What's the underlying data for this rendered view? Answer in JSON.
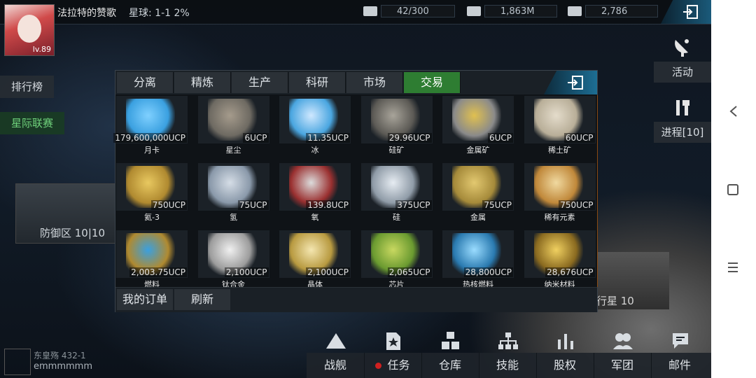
{
  "player": {
    "name": "法拉特的赞歌",
    "level": "lv.89",
    "planet": "星球: 1-1  2%"
  },
  "resources": [
    {
      "icon": "energy-icon",
      "value": "42/300"
    },
    {
      "icon": "money-icon",
      "value": "1,863M"
    },
    {
      "icon": "card-icon",
      "value": "2,786"
    }
  ],
  "left_menu": {
    "ranking": "排行榜",
    "league": "星际联赛",
    "defense": "防御区 10|10"
  },
  "right_menu": {
    "activity": "活动",
    "progress": "进程[10]",
    "planet": "行星 10"
  },
  "modal": {
    "tabs": [
      "分离",
      "精炼",
      "生产",
      "科研",
      "市场",
      "交易"
    ],
    "active_tab": "交易",
    "items": [
      {
        "name": "月卡",
        "price": "179,600,000UCP",
        "icon": "card-icon"
      },
      {
        "name": "星尘",
        "price": "6UCP",
        "icon": "stardust-icon"
      },
      {
        "name": "冰",
        "price": "11.35UCP",
        "icon": "ice-icon"
      },
      {
        "name": "硅矿",
        "price": "29.96UCP",
        "icon": "silicon-ore-icon"
      },
      {
        "name": "金属矿",
        "price": "6UCP",
        "icon": "metal-ore-icon"
      },
      {
        "name": "稀土矿",
        "price": "60UCP",
        "icon": "rare-earth-icon"
      },
      {
        "name": "氦-3",
        "price": "750UCP",
        "icon": "helium-icon"
      },
      {
        "name": "氢",
        "price": "75UCP",
        "icon": "hydrogen-icon"
      },
      {
        "name": "氧",
        "price": "139.8UCP",
        "icon": "oxygen-icon"
      },
      {
        "name": "硅",
        "price": "375UCP",
        "icon": "silicon-icon"
      },
      {
        "name": "金属",
        "price": "75UCP",
        "icon": "metal-icon"
      },
      {
        "name": "稀有元素",
        "price": "750UCP",
        "icon": "flask-icon"
      },
      {
        "name": "燃料",
        "price": "2,003.75UCP",
        "icon": "fuel-icon"
      },
      {
        "name": "钛合金",
        "price": "2,100UCP",
        "icon": "titanium-icon"
      },
      {
        "name": "晶体",
        "price": "2,100UCP",
        "icon": "crystal-icon"
      },
      {
        "name": "芯片",
        "price": "2,065UCP",
        "icon": "chip-icon"
      },
      {
        "name": "热核燃料",
        "price": "28,800UCP",
        "icon": "fusion-fuel-icon"
      },
      {
        "name": "纳米材料",
        "price": "28,676UCP",
        "icon": "nano-material-icon"
      }
    ],
    "buttons": {
      "my_orders": "我的订单",
      "refresh": "刷新"
    }
  },
  "bottom_nav": [
    "战舰",
    "任务",
    "仓库",
    "技能",
    "股权",
    "军团",
    "邮件"
  ],
  "chat": {
    "line1": "东皇殇 432-1",
    "line2": "emmmmmm"
  },
  "colors": {
    "active_tab": "#2e7d32",
    "league_text": "#6fd17b",
    "notification": "#d02020"
  }
}
